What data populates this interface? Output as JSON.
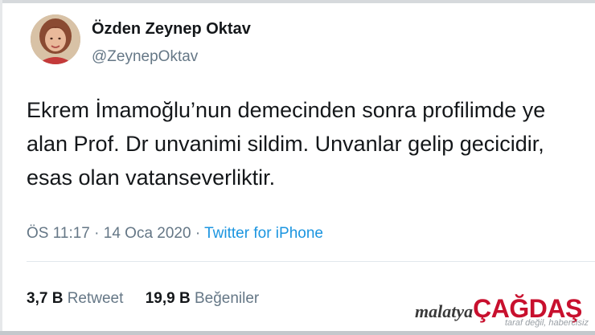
{
  "profile": {
    "display_name": "Özden Zeynep Oktav",
    "handle": "@ZeynepOktav"
  },
  "tweet": {
    "lines": [
      "Ekrem İmamoğlu’nun demecinden sonra profilimde ye",
      "alan Prof. Dr unvanimi sildim. Unvanlar gelip gecicidir,",
      "esas olan vatanseverliktir."
    ],
    "time": "ÖS 11:17",
    "separator": "·",
    "date": "14 Oca 2020",
    "source": "Twitter for iPhone"
  },
  "stats": {
    "retweets_count": "3,7 B",
    "retweets_label": "Retweet",
    "likes_count": "19,9 B",
    "likes_label": "Beğeniler"
  },
  "watermark": {
    "small": "malatya",
    "big": "ÇAĞDAŞ",
    "tagline": "taraf değil, habercisiz"
  }
}
